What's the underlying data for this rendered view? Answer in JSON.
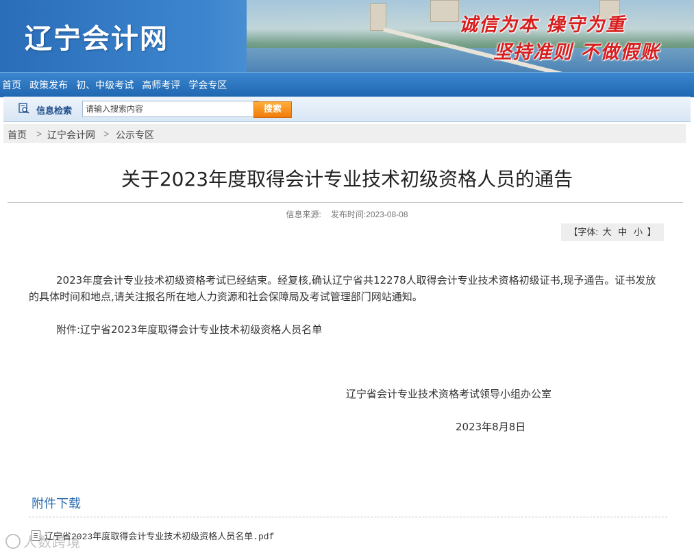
{
  "banner": {
    "site_logo": "辽宁会计网",
    "slogan_line1": "诚信为本 操守为重",
    "slogan_line2": "坚持准则 不做假账"
  },
  "nav": {
    "items": [
      {
        "label": "首页"
      },
      {
        "label": "政策发布"
      },
      {
        "label": "初、中级考试"
      },
      {
        "label": "高师考评"
      },
      {
        "label": "学会专区"
      }
    ]
  },
  "search": {
    "label": "信息检索",
    "placeholder": "请输入搜索内容",
    "button_label": "搜索"
  },
  "breadcrumb": {
    "items": [
      "首页",
      "辽宁会计网",
      "公示专区"
    ],
    "separator": ">"
  },
  "article": {
    "title": "关于2023年度取得会计专业技术初级资格人员的通告",
    "source_label": "信息来源:",
    "date_label": "发布时间:2023-08-08",
    "font_size_label": "【字体:",
    "font_sizes": [
      "大",
      "中",
      "小"
    ],
    "font_size_close": "】",
    "paragraph1": "2023年度会计专业技术初级资格考试已经结束。经复核,确认辽宁省共12278人取得会计专业技术资格初级证书,现予通告。证书发放的具体时间和地点,请关注报名所在地人力资源和社会保障局及考试管理部门网站通知。",
    "paragraph2": "附件:辽宁省2023年度取得会计专业技术初级资格人员名单",
    "signature_org": "辽宁省会计专业技术资格考试领导小组办公室",
    "signature_date": "2023年8月8日"
  },
  "attachments": {
    "heading": "附件下载",
    "files": [
      "辽宁省2023年度取得会计专业技术初级资格人员名单.pdf"
    ]
  },
  "watermark": "人数跨境",
  "colors": {
    "nav_blue": "#1f66b0",
    "search_button": "#f07c0a",
    "slogan_red": "#d81e1e",
    "attachment_heading": "#2b6cb0"
  }
}
